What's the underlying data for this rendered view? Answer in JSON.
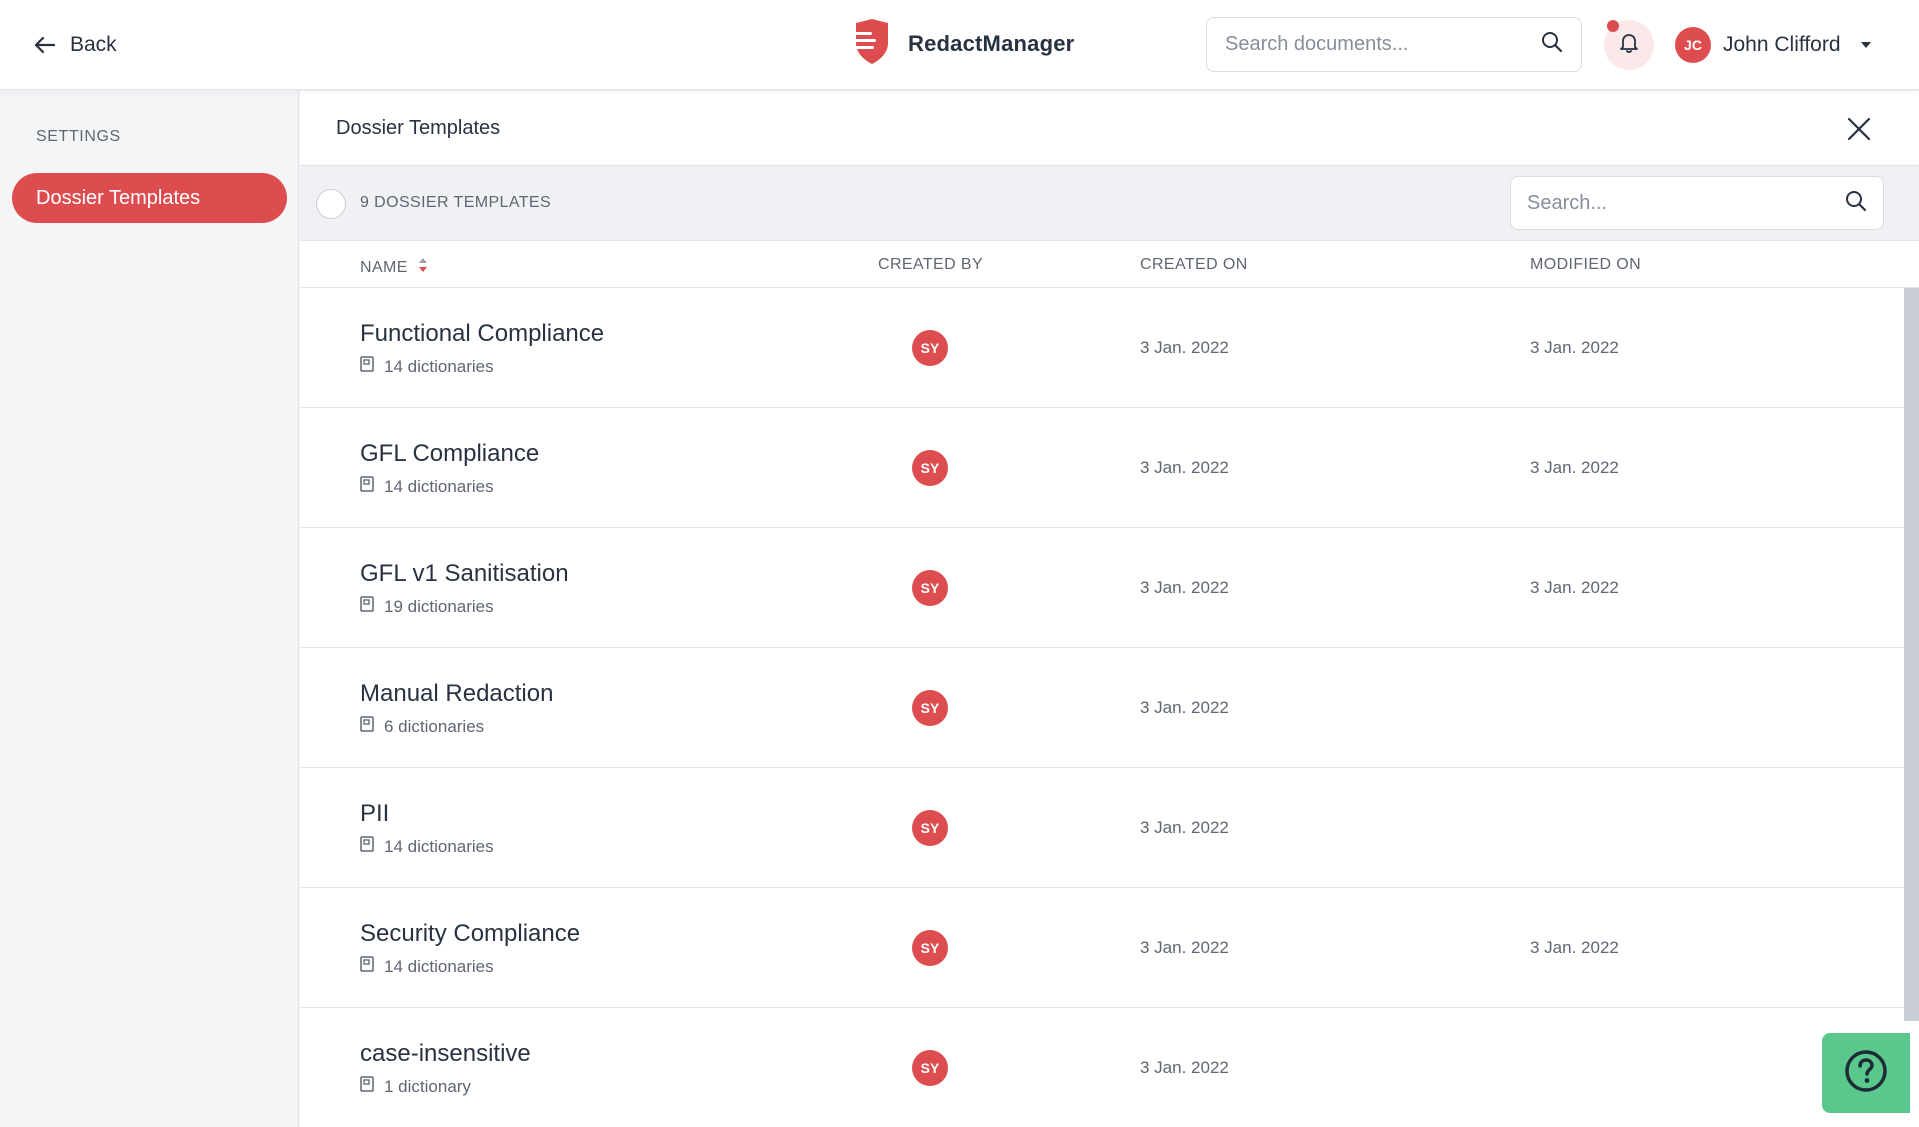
{
  "header": {
    "back_label": "Back",
    "brand_name": "RedactManager",
    "search_placeholder": "Search documents...",
    "user_initials": "JC",
    "user_name": "John Clifford"
  },
  "sidebar": {
    "heading": "SETTINGS",
    "items": [
      {
        "label": "Dossier Templates",
        "active": true
      }
    ]
  },
  "main": {
    "title": "Dossier Templates",
    "count_label": "9 DOSSIER TEMPLATES",
    "table_search_placeholder": "Search...",
    "columns": {
      "name": "NAME",
      "created_by": "CREATED BY",
      "created_on": "CREATED ON",
      "modified_on": "MODIFIED ON"
    },
    "rows": [
      {
        "name": "Functional Compliance",
        "dictionaries": "14 dictionaries",
        "created_by": "SY",
        "created_on": "3 Jan. 2022",
        "modified_on": "3 Jan. 2022"
      },
      {
        "name": "GFL Compliance",
        "dictionaries": "14 dictionaries",
        "created_by": "SY",
        "created_on": "3 Jan. 2022",
        "modified_on": "3 Jan. 2022"
      },
      {
        "name": "GFL v1 Sanitisation",
        "dictionaries": "19 dictionaries",
        "created_by": "SY",
        "created_on": "3 Jan. 2022",
        "modified_on": "3 Jan. 2022"
      },
      {
        "name": "Manual Redaction",
        "dictionaries": "6 dictionaries",
        "created_by": "SY",
        "created_on": "3 Jan. 2022",
        "modified_on": ""
      },
      {
        "name": "PII",
        "dictionaries": "14 dictionaries",
        "created_by": "SY",
        "created_on": "3 Jan. 2022",
        "modified_on": ""
      },
      {
        "name": "Security Compliance",
        "dictionaries": "14 dictionaries",
        "created_by": "SY",
        "created_on": "3 Jan. 2022",
        "modified_on": "3 Jan. 2022"
      },
      {
        "name": "case-insensitive",
        "dictionaries": "1 dictionary",
        "created_by": "SY",
        "created_on": "3 Jan. 2022",
        "modified_on": ""
      }
    ]
  },
  "colors": {
    "accent": "#dd4d50",
    "help_button": "#5ac88c",
    "text": "#283241",
    "muted_text": "#5f6673"
  },
  "icons": {
    "back": "arrow-left-icon",
    "logo": "shield-logo-icon",
    "search": "search-icon",
    "bell": "bell-icon",
    "caret": "chevron-down-icon",
    "close": "close-icon",
    "sort": "sort-icon",
    "dictionary": "dictionary-icon",
    "help": "help-icon"
  }
}
